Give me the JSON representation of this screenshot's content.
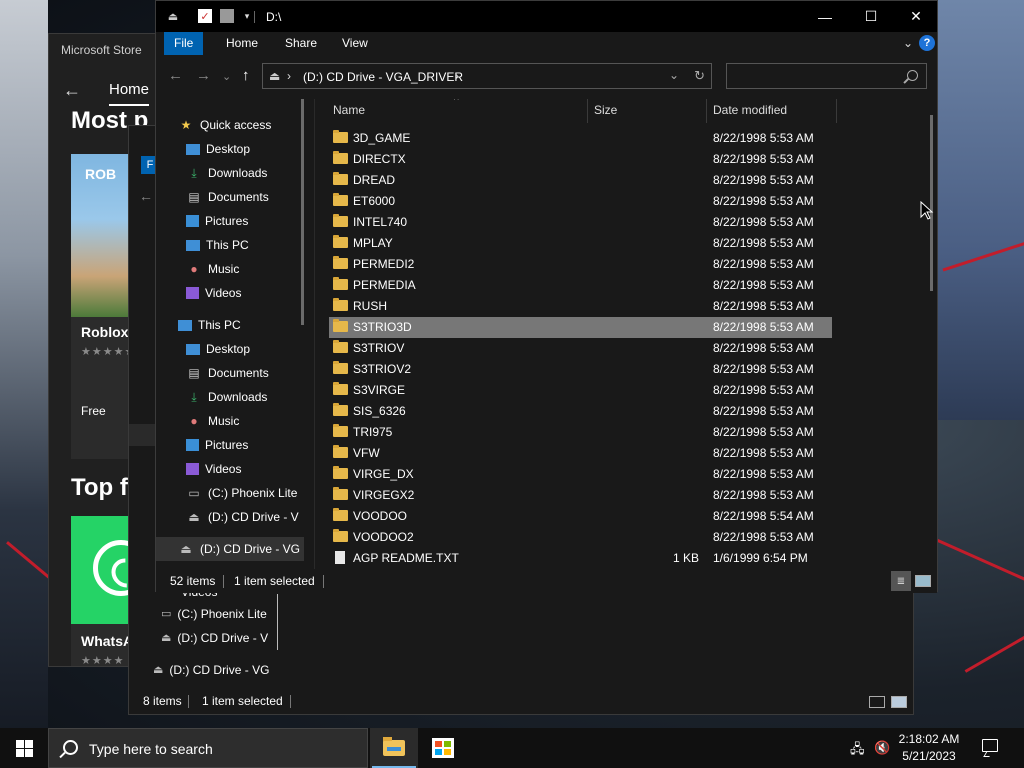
{
  "store": {
    "title": "Microsoft Store",
    "home_tab": "Home",
    "most_heading": "Most p",
    "card1": {
      "tag": "ROB",
      "name": "Roblox",
      "stars": "★★★★★",
      "price": "Free"
    },
    "top_free_heading": "Top fr",
    "card2": {
      "name": "WhatsA",
      "stars": "★★★★"
    }
  },
  "explorer2": {
    "tab_label": "F",
    "nav_items": [
      {
        "label": "Videos"
      },
      {
        "label": "(C:) Phoenix Lite"
      },
      {
        "label": "(D:) CD Drive - V"
      },
      {
        "label": "(D:) CD Drive - VG"
      }
    ],
    "status_count": "8 items",
    "status_selected": "1 item selected"
  },
  "explorer": {
    "title": "D:\\",
    "ribbon_tabs": [
      "File",
      "Home",
      "Share",
      "View"
    ],
    "help_label": "?",
    "address": {
      "path_label": "(D:) CD Drive - VGA_DRIVER",
      "chevron": "›"
    },
    "search_placeholder": "",
    "nav": {
      "quick_access": "Quick access",
      "quick_items": [
        "Desktop",
        "Downloads",
        "Documents",
        "Pictures",
        "This PC",
        "Music",
        "Videos"
      ],
      "this_pc": "This PC",
      "pc_items": [
        "Desktop",
        "Documents",
        "Downloads",
        "Music",
        "Pictures",
        "Videos",
        "(C:) Phoenix Lite",
        "(D:) CD Drive - V"
      ],
      "selected_drive": "(D:) CD Drive - VG"
    },
    "columns": {
      "name": "Name",
      "size": "Size",
      "date": "Date modified"
    },
    "files": [
      {
        "name": "3D_GAME",
        "size": "",
        "date": "8/22/1998 5:53 AM",
        "type": "folder"
      },
      {
        "name": "DIRECTX",
        "size": "",
        "date": "8/22/1998 5:53 AM",
        "type": "folder"
      },
      {
        "name": "DREAD",
        "size": "",
        "date": "8/22/1998 5:53 AM",
        "type": "folder"
      },
      {
        "name": "ET6000",
        "size": "",
        "date": "8/22/1998 5:53 AM",
        "type": "folder"
      },
      {
        "name": "INTEL740",
        "size": "",
        "date": "8/22/1998 5:53 AM",
        "type": "folder"
      },
      {
        "name": "MPLAY",
        "size": "",
        "date": "8/22/1998 5:53 AM",
        "type": "folder"
      },
      {
        "name": "PERMEDI2",
        "size": "",
        "date": "8/22/1998 5:53 AM",
        "type": "folder"
      },
      {
        "name": "PERMEDIA",
        "size": "",
        "date": "8/22/1998 5:53 AM",
        "type": "folder"
      },
      {
        "name": "RUSH",
        "size": "",
        "date": "8/22/1998 5:53 AM",
        "type": "folder"
      },
      {
        "name": "S3TRIO3D",
        "size": "",
        "date": "8/22/1998 5:53 AM",
        "type": "folder",
        "selected": true
      },
      {
        "name": "S3TRIOV",
        "size": "",
        "date": "8/22/1998 5:53 AM",
        "type": "folder"
      },
      {
        "name": "S3TRIOV2",
        "size": "",
        "date": "8/22/1998 5:53 AM",
        "type": "folder"
      },
      {
        "name": "S3VIRGE",
        "size": "",
        "date": "8/22/1998 5:53 AM",
        "type": "folder"
      },
      {
        "name": "SIS_6326",
        "size": "",
        "date": "8/22/1998 5:53 AM",
        "type": "folder"
      },
      {
        "name": "TRI975",
        "size": "",
        "date": "8/22/1998 5:53 AM",
        "type": "folder"
      },
      {
        "name": "VFW",
        "size": "",
        "date": "8/22/1998 5:53 AM",
        "type": "folder"
      },
      {
        "name": "VIRGE_DX",
        "size": "",
        "date": "8/22/1998 5:53 AM",
        "type": "folder"
      },
      {
        "name": "VIRGEGX2",
        "size": "",
        "date": "8/22/1998 5:53 AM",
        "type": "folder"
      },
      {
        "name": "VOODOO",
        "size": "",
        "date": "8/22/1998 5:54 AM",
        "type": "folder"
      },
      {
        "name": "VOODOO2",
        "size": "",
        "date": "8/22/1998 5:53 AM",
        "type": "folder"
      },
      {
        "name": "AGP README.TXT",
        "size": "1 KB",
        "date": "1/6/1999 6:54 PM",
        "type": "text"
      }
    ],
    "status_count": "52 items",
    "status_selected": "1 item selected"
  },
  "taskbar": {
    "search_text": "Type here to search",
    "time": "2:18:02 AM",
    "date": "5/21/2023"
  },
  "colors": {
    "accent": "#0063b1",
    "selection": "#777777",
    "folder": "#e6b84a",
    "window_bg": "#191919"
  }
}
